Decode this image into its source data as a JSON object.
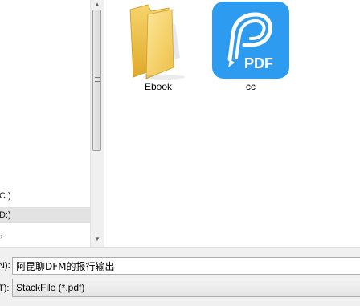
{
  "navigation": {
    "items": [
      {
        "label": "C:)",
        "selected": false
      },
      {
        "label": "D:)",
        "selected": true
      },
      {
        "label": "",
        "selected": false
      }
    ]
  },
  "files": [
    {
      "name": "Ebook",
      "type": "folder",
      "icon": "folder-icon"
    },
    {
      "name": "cc",
      "type": "pdf",
      "icon": "pdf-app-icon",
      "badge": "PDF"
    }
  ],
  "form": {
    "filename_label": "N):",
    "filename_value": "阿昆聊DFM的报行输出",
    "filetype_label": "T):",
    "filetype_value": "StackFile (*.pdf)"
  },
  "colors": {
    "pdf_icon_blue": "#2d9bf0",
    "folder_yellow": "#f2c94c",
    "selected_row": "#e3e3e3"
  }
}
